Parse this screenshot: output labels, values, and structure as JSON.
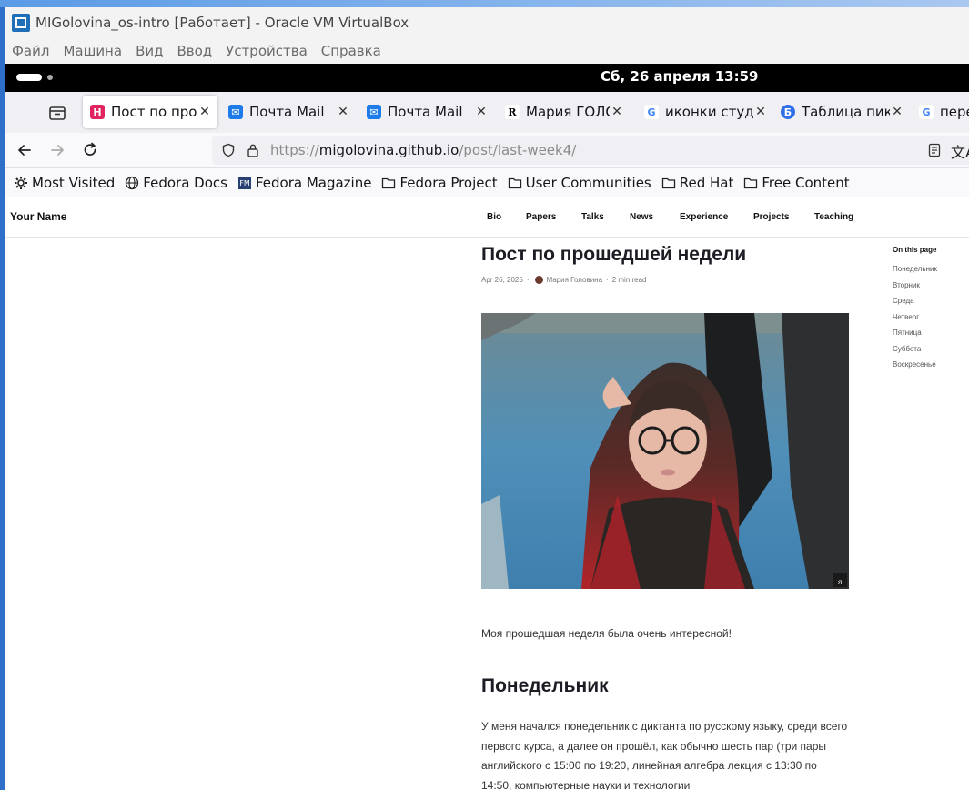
{
  "vbox": {
    "title": "MIGolovina_os-intro [Работает] - Oracle VM VirtualBox",
    "menu": [
      "Файл",
      "Машина",
      "Вид",
      "Ввод",
      "Устройства",
      "Справка"
    ]
  },
  "gnome": {
    "clock": "Сб, 26 апреля  13:59"
  },
  "tabs": [
    {
      "title": "Пост по прошедшей неделе",
      "favicon": "H",
      "color": "#e0245e"
    },
    {
      "title": "Почта Mail",
      "favicon": "mail",
      "color": "#1e7be9"
    },
    {
      "title": "Почта Mail",
      "favicon": "mail",
      "color": "#1e7be9"
    },
    {
      "title": "Мария ГОЛОВИНА",
      "favicon": "R",
      "color": "#000000"
    },
    {
      "title": "иконки студента",
      "favicon": "G",
      "color": "#4285f4"
    },
    {
      "title": "Таблица пиктограмм",
      "favicon": "Б",
      "color": "#2f6fe8"
    },
    {
      "title": "перевод",
      "favicon": "G",
      "color": "#4285f4"
    }
  ],
  "url": {
    "prefix": "https://",
    "domain": "migolovina.github.io",
    "path": "/post/last-week4/"
  },
  "bookmarks": [
    "Most Visited",
    "Fedora Docs",
    "Fedora Magazine",
    "Fedora Project",
    "User Communities",
    "Red Hat",
    "Free Content"
  ],
  "site": {
    "name": "Your Name",
    "links": [
      "Bio",
      "Papers",
      "Talks",
      "News",
      "Experience",
      "Projects",
      "Teaching"
    ]
  },
  "post": {
    "title": "Пост по прошедшей недели",
    "date": "Apr 26, 2025",
    "author": "Мария Головина",
    "read_time": "2 min read",
    "photo_caption": "я",
    "intro": "Моя прошедшая неделя была очень интересной!",
    "section_title": "Понедельник",
    "section_text": "У меня начался понедельник с диктанта по русскому языку, среди всего первого курса, а далее он прошёл, как обычно шесть пар (три пары английского с 15:00 по 19:20, линейная алгебра лекция с 13:30 по 14:50, компьютерные науки и технологии"
  },
  "toc": {
    "heading": "On this page",
    "items": [
      "Понедельник",
      "Вторник",
      "Среда",
      "Четверг",
      "Пятница",
      "Суббота",
      "Воскресенье"
    ]
  }
}
